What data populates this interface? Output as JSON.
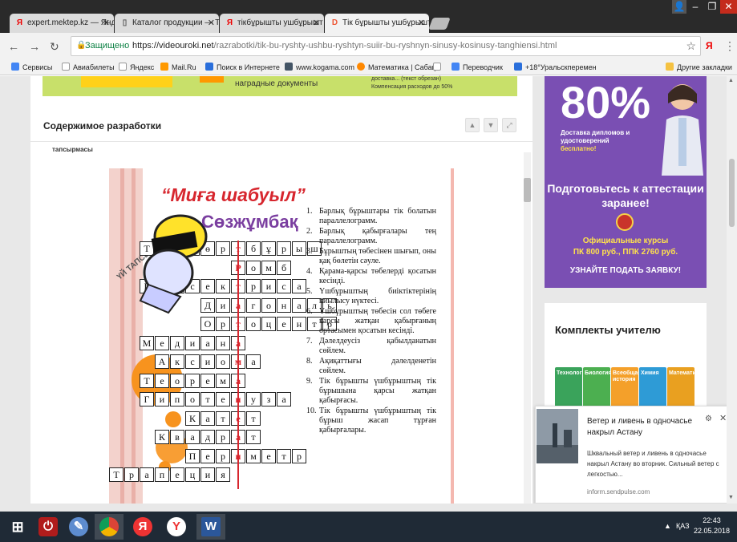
{
  "tabs": [
    {
      "label": "expert.mektep.kz — Янде",
      "icon": "Я",
      "color": "#e00"
    },
    {
      "label": "Каталог продукции — Т",
      "icon": "▯",
      "color": "#555"
    },
    {
      "label": "тікбұрышты ушбұрышт",
      "icon": "Я",
      "color": "#e00"
    },
    {
      "label": "Тік бұрышты ушбұрышт",
      "icon": "D",
      "color": "#e53"
    }
  ],
  "address": {
    "secure_label": "Защищено",
    "url_host": "https://videouroki.net",
    "url_path": "/razrabotki/tik-bu-ryshty-ushbu-ryshtyn-suiir-bu-ryshnyn-sinusy-kosinusy-tanghiensi.html"
  },
  "bookmarks": [
    {
      "label": "Сервисы",
      "color": "#4285f4"
    },
    {
      "label": "Авиабилеты",
      "color": "#999"
    },
    {
      "label": "Яндекс",
      "color": "#999"
    },
    {
      "label": "Mail.Ru",
      "color": "#f90"
    },
    {
      "label": "Поиск в Интернете",
      "color": "#2a6fdb"
    },
    {
      "label": "www.kogama.com",
      "color": "#456"
    },
    {
      "label": "Математика | Сабақ",
      "color": "#f80"
    },
    {
      "label": "",
      "color": "#999"
    },
    {
      "label": "Переводчик",
      "color": "#4285f4"
    },
    {
      "label": "+18°Уральскперемен",
      "color": "#2a6fdb"
    }
  ],
  "other_bookmarks": "Другие закладки",
  "banner": {
    "line1": "наградные документы",
    "line2": "доставка... (текст обрезан)",
    "line3": "Компенсация расходов до 50%"
  },
  "dev": {
    "title": "Содержимое разработки"
  },
  "cut_line": "тапсырмасы",
  "slide": {
    "title": "“Миға шабуыл”",
    "subtitle": "Сөзжұмбақ",
    "diag": "ҮЙ ТАПСЫРМАСЫН",
    "clues": [
      "Барлық бұрыштары тік болатын параллелограмм.",
      "Барлық қабырғалары тең параллелограмм.",
      "Бұрыштың төбесінен шығып, оны қақ бөлетін сәуле.",
      "Қарама-қарсы төбелерді қосатын кесінді.",
      "Үшбұрыштың биіктіктерінің қиылысу нүктесі.",
      "Үшбұрыштың төбесін сол төбеге қарсы жатқан қабырғаның ортасымен қосатын кесінді.",
      "Дәлелдеусіз қабылданатын сөйлем.",
      "Ақиқаттығы дәлелденетін сөйлем.",
      "Тік бұрышты үшбұрыштың тік бұрышына қарсы жатқан қабырғасы.",
      "Тік бұрышты үшбұрыштың тік бұрыш жасап тұрған қабырғалары."
    ],
    "rows": [
      {
        "letters": "Тiк төртбұрыш",
        "start": 1,
        "key": 6
      },
      {
        "letters": "Ромб",
        "start": 9,
        "key": 0
      },
      {
        "letters": "Биссектриса",
        "start": 0,
        "key": 6
      },
      {
        "letters": "Диагональ",
        "start": 4,
        "key": 2
      },
      {
        "letters": "Ортоцентр",
        "start": 4,
        "key": 2
      },
      {
        "letters": "Медиана",
        "start": 2,
        "key": 6
      },
      {
        "letters": "Аксиома",
        "start": 3,
        "key": 5
      },
      {
        "letters": "Теорема",
        "start": 2,
        "key": 6
      },
      {
        "letters": "Гипотенуза",
        "start": 2,
        "key": 6
      },
      {
        "letters": "Катет",
        "start": 5,
        "key": 3
      },
      {
        "letters": "Квадрат",
        "start": 3,
        "key": 5
      },
      {
        "letters": "Периметр",
        "start": 5,
        "key": 3
      },
      {
        "letters": "Трапеция",
        "start": 0,
        "key": 8
      }
    ]
  },
  "ad": {
    "big": "80%",
    "small1": "Доставка дипломов и удостоверений",
    "small2": "бесплатно!",
    "headline": "Подготовьтесь к аттестации заранее!",
    "course_title": "Официальные курсы",
    "course_price": "ПК 800 руб., ППК 2760 руб.",
    "cta": "УЗНАЙТЕ ПОДАТЬ ЗАЯВКУ!"
  },
  "kits": {
    "title": "Комплекты учителю",
    "books": [
      {
        "label": "Технология",
        "color": "#3aa35b"
      },
      {
        "label": "Биология",
        "color": "#4caf50"
      },
      {
        "label": "Всеобщая история",
        "color": "#f4a02a"
      },
      {
        "label": "Химия",
        "color": "#2e9bd6"
      },
      {
        "label": "Математика",
        "color": "#e9a020"
      }
    ]
  },
  "notification": {
    "title": "Ветер и ливень в одночасье накрыл Астану",
    "body": "Шквальный ветер и ливень в одночасье накрыл Астану во вторник. Сильный ветер с легкостью...",
    "source": "inform.sendpulse.com"
  },
  "taskbar": {
    "lang": "ҚАЗ",
    "time": "22:43",
    "date": "22.05.2018"
  }
}
